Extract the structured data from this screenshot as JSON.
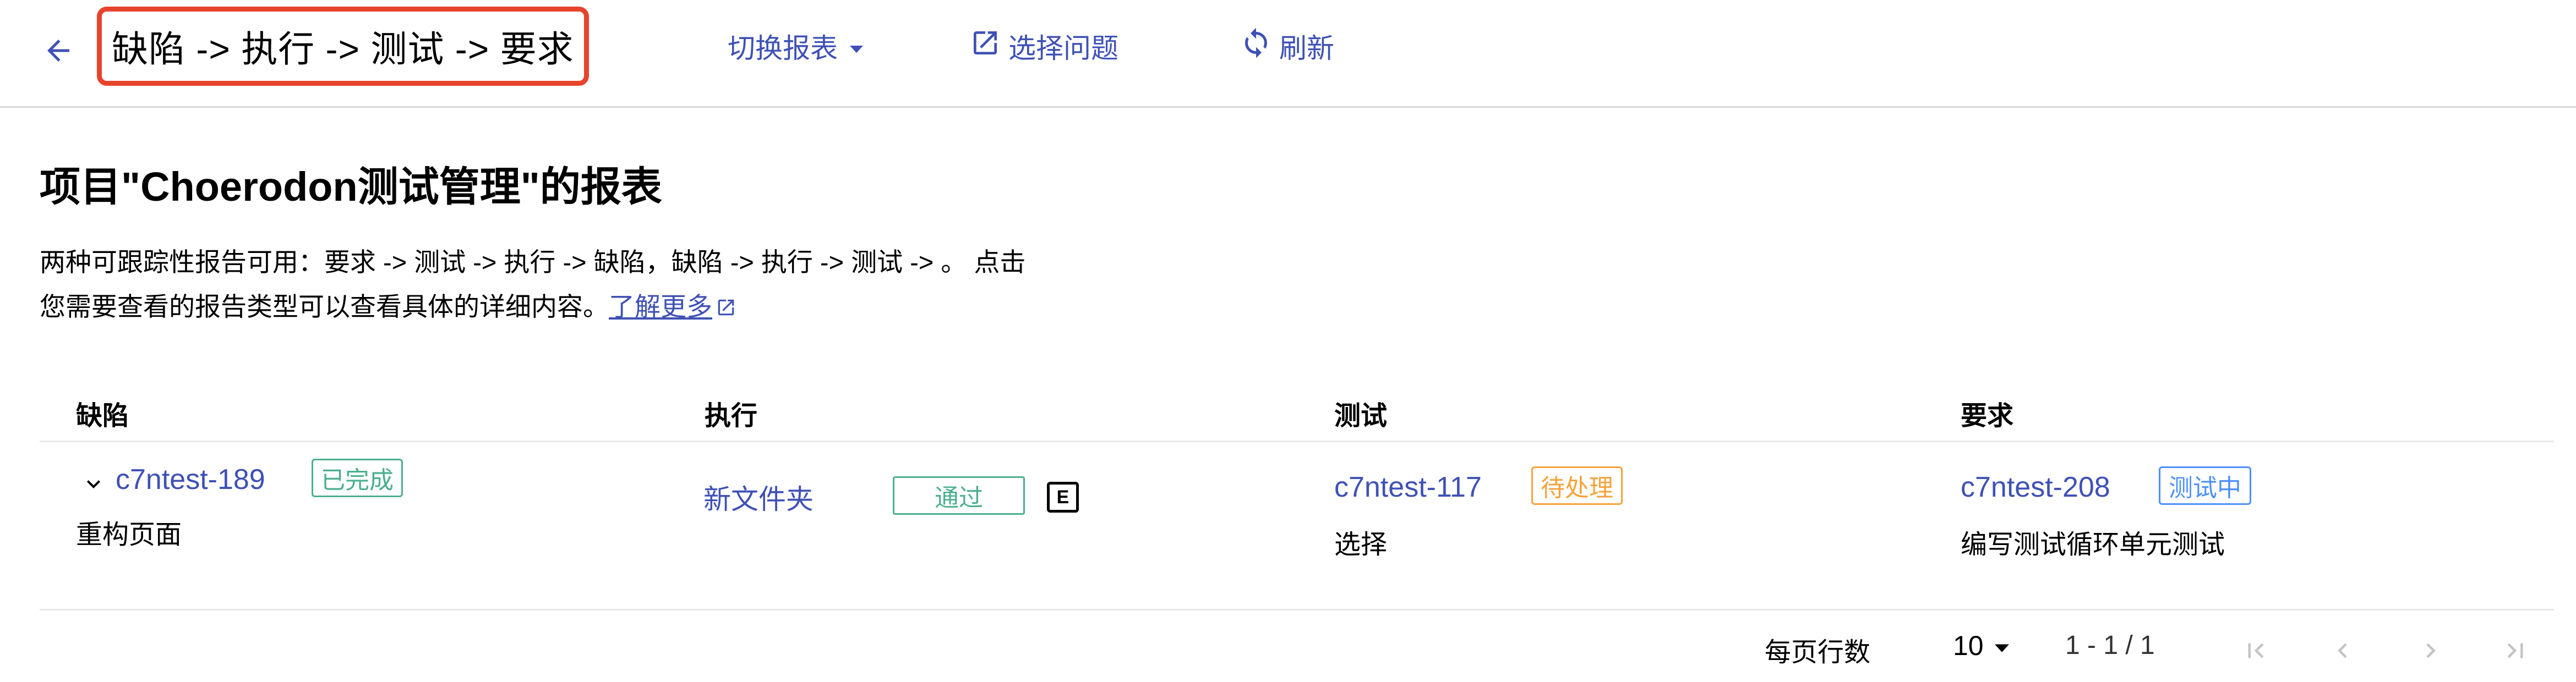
{
  "header": {
    "title": "缺陷 -> 执行 -> 测试 -> 要求",
    "switch_report": "切换报表",
    "select_issue": "选择问题",
    "refresh": "刷新"
  },
  "page": {
    "title": "项目\"Choerodon测试管理\"的报表",
    "desc_line1": "两种可跟踪性报告可用：要求 -> 测试 -> 执行 -> 缺陷，缺陷 -> 执行 -> 测试 -> 。 点击",
    "desc_line2": "您需要查看的报告类型可以查看具体的详细内容。",
    "learn_more": "了解更多"
  },
  "table": {
    "columns": [
      "缺陷",
      "执行",
      "测试",
      "要求"
    ],
    "rows": [
      {
        "defect": {
          "id": "c7ntest-189",
          "status": "已完成",
          "summary": "重构页面"
        },
        "execution": {
          "name": "新文件夹",
          "status": "通过",
          "badge": "E"
        },
        "test": {
          "id": "c7ntest-117",
          "status": "待处理",
          "summary": "选择"
        },
        "requirement": {
          "id": "c7ntest-208",
          "status": "测试中",
          "summary": "编写测试循环单元测试"
        }
      }
    ]
  },
  "pagination": {
    "rows_per_page_label": "每页行数",
    "page_size": "10",
    "range": "1 - 1 / 1"
  },
  "colors": {
    "accent": "#3f51b5",
    "highlight_border": "#e8432d",
    "status_done": "#4caf8e",
    "status_todo": "#f6a33b",
    "status_testing": "#4d90fe"
  },
  "icons": {
    "back": "arrow-left-icon",
    "switch_caret": "caret-down-icon",
    "select": "open-in-new-icon",
    "refresh": "refresh-icon",
    "expand": "chevron-down-icon",
    "external": "open-in-new-icon",
    "first": "first-page-icon",
    "prev": "chevron-left-icon",
    "next": "chevron-right-icon",
    "last": "last-page-icon"
  }
}
